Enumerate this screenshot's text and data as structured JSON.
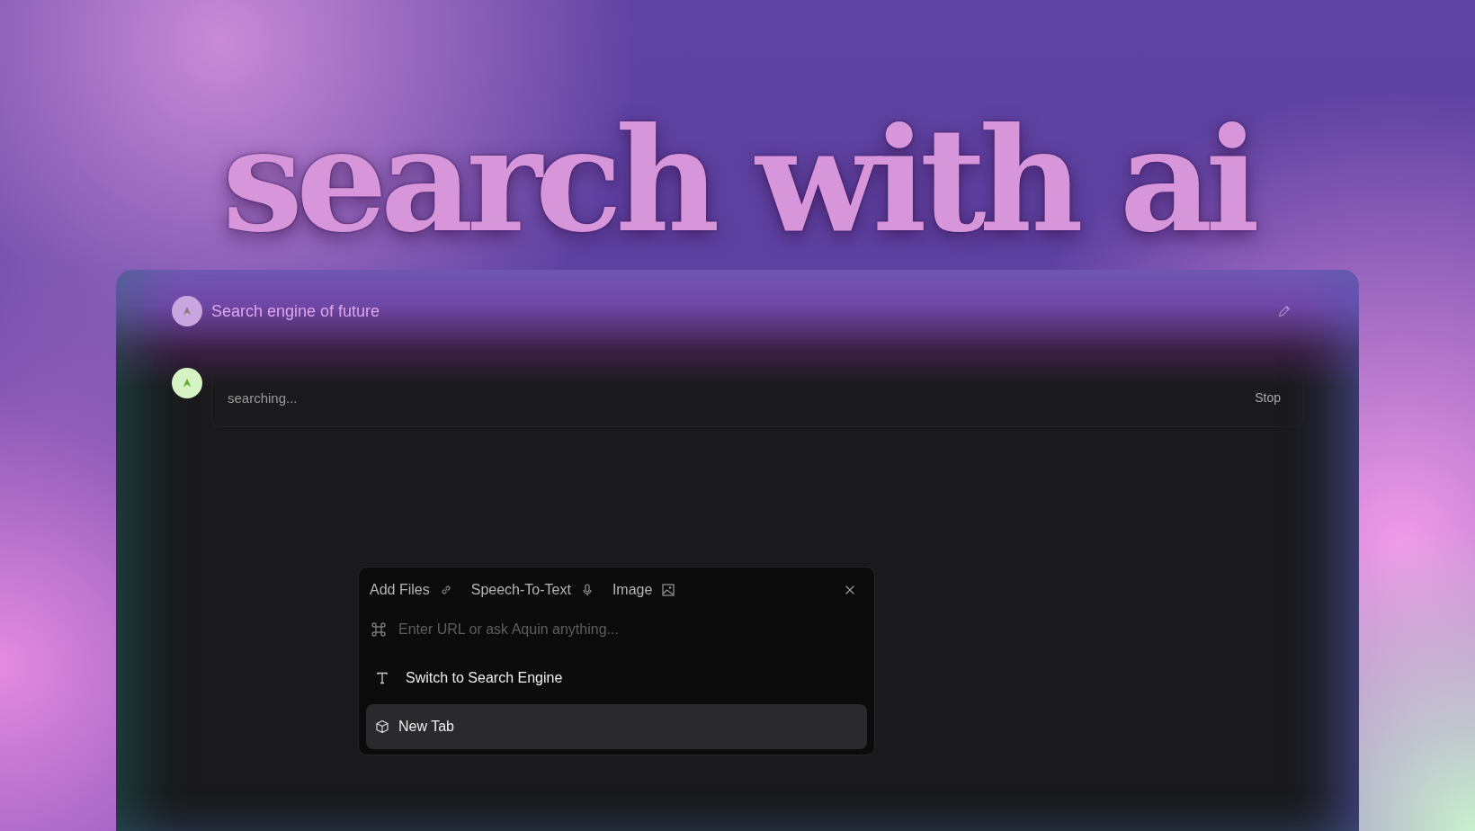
{
  "headline": "search with ai",
  "chat": {
    "title": "Search engine of future",
    "status": "searching...",
    "stop_label": "Stop"
  },
  "palette": {
    "tools": [
      {
        "kind": "link",
        "label": "Add Files"
      },
      {
        "kind": "mic",
        "label": "Speech-To-Text"
      },
      {
        "kind": "image",
        "label": "Image"
      }
    ],
    "placeholder": "Enter URL or ask Aquin anything...",
    "commands": [
      {
        "kind": "text",
        "label": "Switch to Search Engine",
        "selected": false
      },
      {
        "kind": "cube",
        "label": "New Tab",
        "selected": true
      }
    ]
  }
}
